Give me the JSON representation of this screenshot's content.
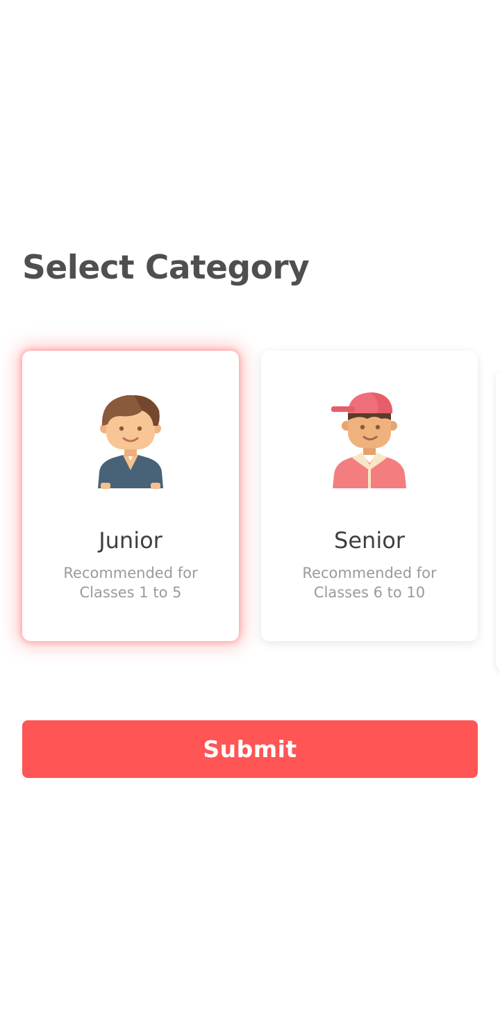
{
  "page": {
    "title": "Select Category"
  },
  "categories": [
    {
      "id": "junior",
      "title": "Junior",
      "desc_line1": "Recommended for",
      "desc_line2": "Classes 1 to 5",
      "selected": true,
      "icon": "junior-boy-avatar-icon"
    },
    {
      "id": "senior",
      "title": "Senior",
      "desc_line1": "Recommended for",
      "desc_line2": "Classes 6 to 10",
      "selected": false,
      "icon": "senior-boy-cap-avatar-icon"
    }
  ],
  "actions": {
    "submit_label": "Submit"
  },
  "colors": {
    "accent": "#ff5555",
    "title_text": "#4f4f4f",
    "muted_text": "#9a9a9a"
  }
}
